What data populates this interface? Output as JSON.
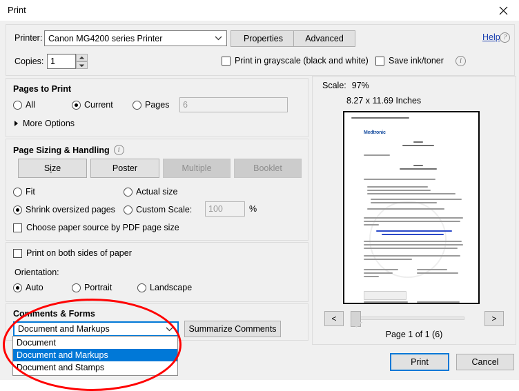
{
  "window": {
    "title": "Print",
    "close_icon": "close-icon"
  },
  "printer": {
    "label": "Printer:",
    "value": "Canon MG4200 series Printer",
    "properties_button": "Properties",
    "advanced_button": "Advanced",
    "help_link": "Help",
    "help_icon": "question-circle-icon"
  },
  "copies": {
    "label": "Copies:",
    "value": "1",
    "spinner_icon": "spinner-up-down-icon"
  },
  "options": {
    "grayscale_label": "Print in grayscale (black and white)",
    "grayscale_checked": false,
    "save_ink_label": "Save ink/toner",
    "save_ink_checked": false,
    "info_icon": "info-icon"
  },
  "pages_to_print": {
    "title": "Pages to Print",
    "radios": [
      {
        "label": "All",
        "checked": false
      },
      {
        "label": "Current",
        "checked": true
      },
      {
        "label": "Pages",
        "checked": false
      }
    ],
    "pages_value": "6",
    "more_options": "More Options",
    "more_options_icon": "triangle-right-icon"
  },
  "page_sizing": {
    "title": "Page Sizing & Handling",
    "info_icon": "info-icon",
    "buttons": [
      {
        "label": "Size",
        "disabled": false
      },
      {
        "label": "Poster",
        "disabled": false
      },
      {
        "label": "Multiple",
        "disabled": true
      },
      {
        "label": "Booklet",
        "disabled": true
      }
    ],
    "fit_label": "Fit",
    "fit_checked": false,
    "actual_size_label": "Actual size",
    "actual_size_checked": false,
    "shrink_label": "Shrink oversized pages",
    "shrink_checked": true,
    "custom_scale_label": "Custom Scale:",
    "custom_scale_checked": false,
    "custom_scale_value": "100",
    "percent_label": "%",
    "paper_source_label": "Choose paper source by PDF page size",
    "paper_source_checked": false
  },
  "duplex": {
    "label": "Print on both sides of paper",
    "checked": false
  },
  "orientation": {
    "title": "Orientation:",
    "radios": [
      {
        "label": "Auto",
        "checked": true
      },
      {
        "label": "Portrait",
        "checked": false
      },
      {
        "label": "Landscape",
        "checked": false
      }
    ]
  },
  "comments_forms": {
    "title": "Comments & Forms",
    "selected": "Document and Markups",
    "arrow_icon": "chevron-down-icon",
    "summarize_button": "Summarize Comments",
    "dropdown_open": true,
    "dropdown_items": [
      {
        "label": "Document",
        "selected": false
      },
      {
        "label": "Document and Markups",
        "selected": true
      },
      {
        "label": "Document and Stamps",
        "selected": false
      }
    ]
  },
  "preview": {
    "scale_label": "Scale:",
    "scale_value": "97%",
    "dimensions": "8.27 x 11.69 Inches",
    "page_indicator": "Page 1 of 1 (6)",
    "prev_button": "<",
    "next_button": ">",
    "document": {
      "brand": "Medtronic",
      "heading1": "zu",
      "heading1_sub": "Anschreiben",
      "heading2": "zu",
      "heading2_sub": "Vertragsdokumente"
    }
  },
  "footer": {
    "print_button": "Print",
    "cancel_button": "Cancel"
  },
  "annotation": {
    "shape": "red-oval-highlight",
    "color": "#ff0000"
  }
}
